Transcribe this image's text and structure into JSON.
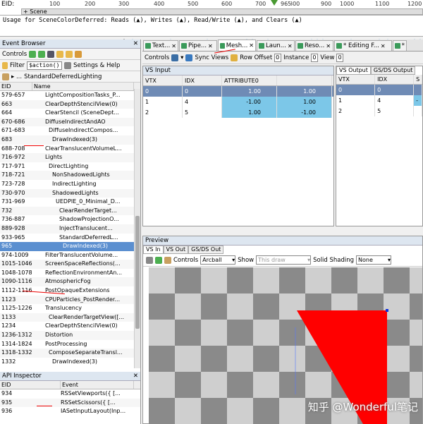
{
  "timeline": {
    "eid_label": "EID:",
    "ticks": [
      "100",
      "200",
      "300",
      "400",
      "500",
      "600",
      "700",
      "800",
      "900",
      "965",
      "1000",
      "1100",
      "1200"
    ],
    "scene_label": "+ Scene"
  },
  "usage": {
    "text": "Usage for SceneColorDeferred: Reads (▲), Writes (▲), Read/Write (▲), and Clears (▲)"
  },
  "event_browser": {
    "title": "Event Browser",
    "controls_label": "Controls",
    "filter_label": "Filter",
    "filter_value": "$action()",
    "settings_label": "Settings & Help",
    "breadcrumb": "StandardDeferredLighting",
    "columns": [
      "EID",
      "Name"
    ],
    "rows": [
      {
        "eid": "579-657",
        "name": "LightCompositionTasks_P..."
      },
      {
        "eid": "663",
        "name": "ClearDepthStencilView(0)"
      },
      {
        "eid": "664",
        "name": "ClearStencil (SceneDept..."
      },
      {
        "eid": "670-686",
        "name": "DiffuseIndirectAndAO"
      },
      {
        "eid": "671-683",
        "name": "DiffuseIndirectCompos..."
      },
      {
        "eid": "683",
        "name": "DrawIndexed(3)"
      },
      {
        "eid": "688-708",
        "name": "ClearTranslucentVolumeL..."
      },
      {
        "eid": "716-972",
        "name": "Lights"
      },
      {
        "eid": "717-971",
        "name": "DirectLighting"
      },
      {
        "eid": "718-721",
        "name": "NonShadowedLights"
      },
      {
        "eid": "723-728",
        "name": "IndirectLighting"
      },
      {
        "eid": "730-970",
        "name": "ShadowedLights"
      },
      {
        "eid": "731-969",
        "name": "UEDPIE_0_Minimal_D..."
      },
      {
        "eid": "732",
        "name": "ClearRenderTarget..."
      },
      {
        "eid": "736-887",
        "name": "ShadowProjectionO..."
      },
      {
        "eid": "889-928",
        "name": "InjectTranslucent..."
      },
      {
        "eid": "933-965",
        "name": "StandardDeferredL..."
      },
      {
        "eid": "965",
        "name": "DrawIndexed(3)"
      },
      {
        "eid": "974-1009",
        "name": "FilterTranslucentVolume..."
      },
      {
        "eid": "1015-1046",
        "name": "ScreenSpaceReflections(..."
      },
      {
        "eid": "1048-1078",
        "name": "ReflectionEnvironmentAn..."
      },
      {
        "eid": "1090-1116",
        "name": "AtmosphericFog"
      },
      {
        "eid": "1112-1116",
        "name": "PostOpaqueExtensions"
      },
      {
        "eid": "1123",
        "name": "CPUParticles_PostRender..."
      },
      {
        "eid": "1125-1226",
        "name": "Translucency"
      },
      {
        "eid": "1133",
        "name": "ClearRenderTargetView([..."
      },
      {
        "eid": "1234",
        "name": "ClearDepthStencilView(0)"
      },
      {
        "eid": "1236-1312",
        "name": "Distortion"
      },
      {
        "eid": "1314-1824",
        "name": "PostProcessing"
      },
      {
        "eid": "1318-1332",
        "name": "ComposeSeparateTransl..."
      },
      {
        "eid": "1332",
        "name": "DrawIndexed(3)"
      }
    ]
  },
  "api_inspector": {
    "title": "API Inspector",
    "columns": [
      "EID",
      "Event"
    ],
    "rows": [
      {
        "eid": "934",
        "name": "RSSetViewports({ [..."
      },
      {
        "eid": "935",
        "name": "RSSetScissors({ [..."
      },
      {
        "eid": "936",
        "name": "IASetInputLayout(Inp..."
      }
    ]
  },
  "tabs": [
    "Text...",
    "Pipe...",
    "Mesh...",
    "Laun...",
    "Reso...",
    "* Editing F...",
    "*"
  ],
  "mesh": {
    "controls_label": "Controls",
    "sync_label": "Sync Views",
    "row_offset_label": "Row Offset",
    "row_offset_value": "0",
    "instance_label": "Instance",
    "instance_value": "0",
    "view_label": "View",
    "view_value": "0",
    "vs_input_title": "VS Input",
    "vs_input_cols": [
      "VTX",
      "IDX",
      "ATTRIBUTE0",
      "",
      ""
    ],
    "vs_input_rows": [
      [
        "0",
        "0",
        "1.00",
        "1.00",
        ""
      ],
      [
        "1",
        "4",
        "-1.00",
        "1.00",
        ""
      ],
      [
        "2",
        "5",
        "1.00",
        "-1.00",
        ""
      ]
    ],
    "vs_output_tabs": [
      "VS Output",
      "GS/DS Output"
    ],
    "vs_output_cols": [
      "VTX",
      "IDX",
      "S"
    ],
    "vs_output_rows": [
      [
        "0",
        "0",
        ""
      ],
      [
        "1",
        "4",
        "-"
      ],
      [
        "2",
        "5",
        ""
      ]
    ]
  },
  "preview": {
    "title": "Preview",
    "tabs": [
      "VS In",
      "VS Out",
      "GS/DS Out"
    ],
    "controls_label": "Controls",
    "camera_value": "Arcball",
    "show_label": "Show",
    "show_value": "This draw",
    "shading_label": "Solid Shading",
    "shading_value": "None",
    "watermark": "知乎 @Wonderful笔记"
  }
}
